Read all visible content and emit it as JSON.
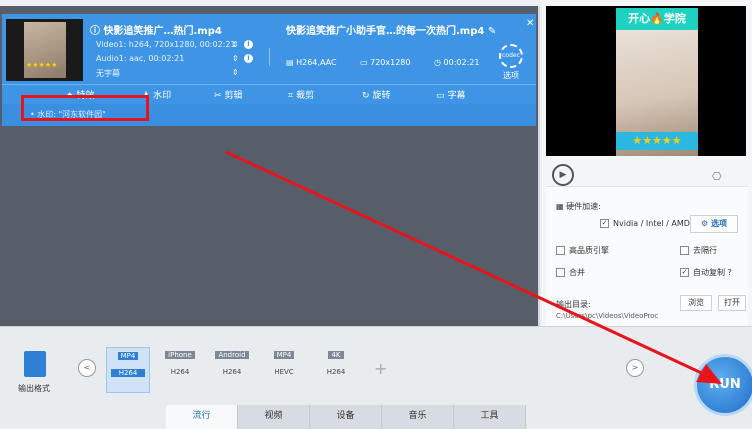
{
  "task": {
    "src_title": "快影追笑推广…热门.mp4",
    "video_line": "Video1: h264, 720x1280, 00:02:21",
    "audio_line": "Audio1: aac, 00:02:21",
    "subtitle_line": "无字幕",
    "dst_title": "快影追笑推广小助手官…的每一次热门.mp4",
    "dst_codec": "H264,AAC",
    "dst_res": "720x1280",
    "dst_dur": "00:02:21",
    "codec_label": "选项",
    "tools": [
      {
        "icon": "✦",
        "label": "特效"
      },
      {
        "icon": "♟",
        "label": "水印"
      },
      {
        "icon": "✂",
        "label": "剪辑"
      },
      {
        "icon": "⌗",
        "label": "裁剪"
      },
      {
        "icon": "↻",
        "label": "旋转"
      },
      {
        "icon": "▭",
        "label": "字幕"
      }
    ],
    "watermark_line": "• 水印: \"河东软件园\""
  },
  "preview": {
    "title": "开心🔥学院",
    "stars": "★★★★★"
  },
  "options": {
    "hw_label": "硬件加速:",
    "hw_check": "Nvidia / Intel / AMD",
    "opt_button": "选项",
    "high_quality": "高品质引擎",
    "deinterlace": "去隔行",
    "merge": "合并",
    "auto_copy": "自动复制",
    "help": "?",
    "output_label": "输出目录:",
    "output_path": "C:\\Users\\pc\\Videos\\VideoProc",
    "browse": "浏览",
    "open": "打开"
  },
  "bottom": {
    "output_format": "输出格式",
    "formats": [
      {
        "tag": "MP4",
        "sub": "H264"
      },
      {
        "tag": "iPhone",
        "sub": "H264"
      },
      {
        "tag": "Android",
        "sub": "H264"
      },
      {
        "tag": "MP4",
        "sub": "HEVC"
      },
      {
        "tag": "4K",
        "sub": "H264"
      }
    ],
    "tabs": [
      "流行",
      "视频",
      "设备",
      "音乐",
      "工具"
    ],
    "run": "RUN"
  }
}
